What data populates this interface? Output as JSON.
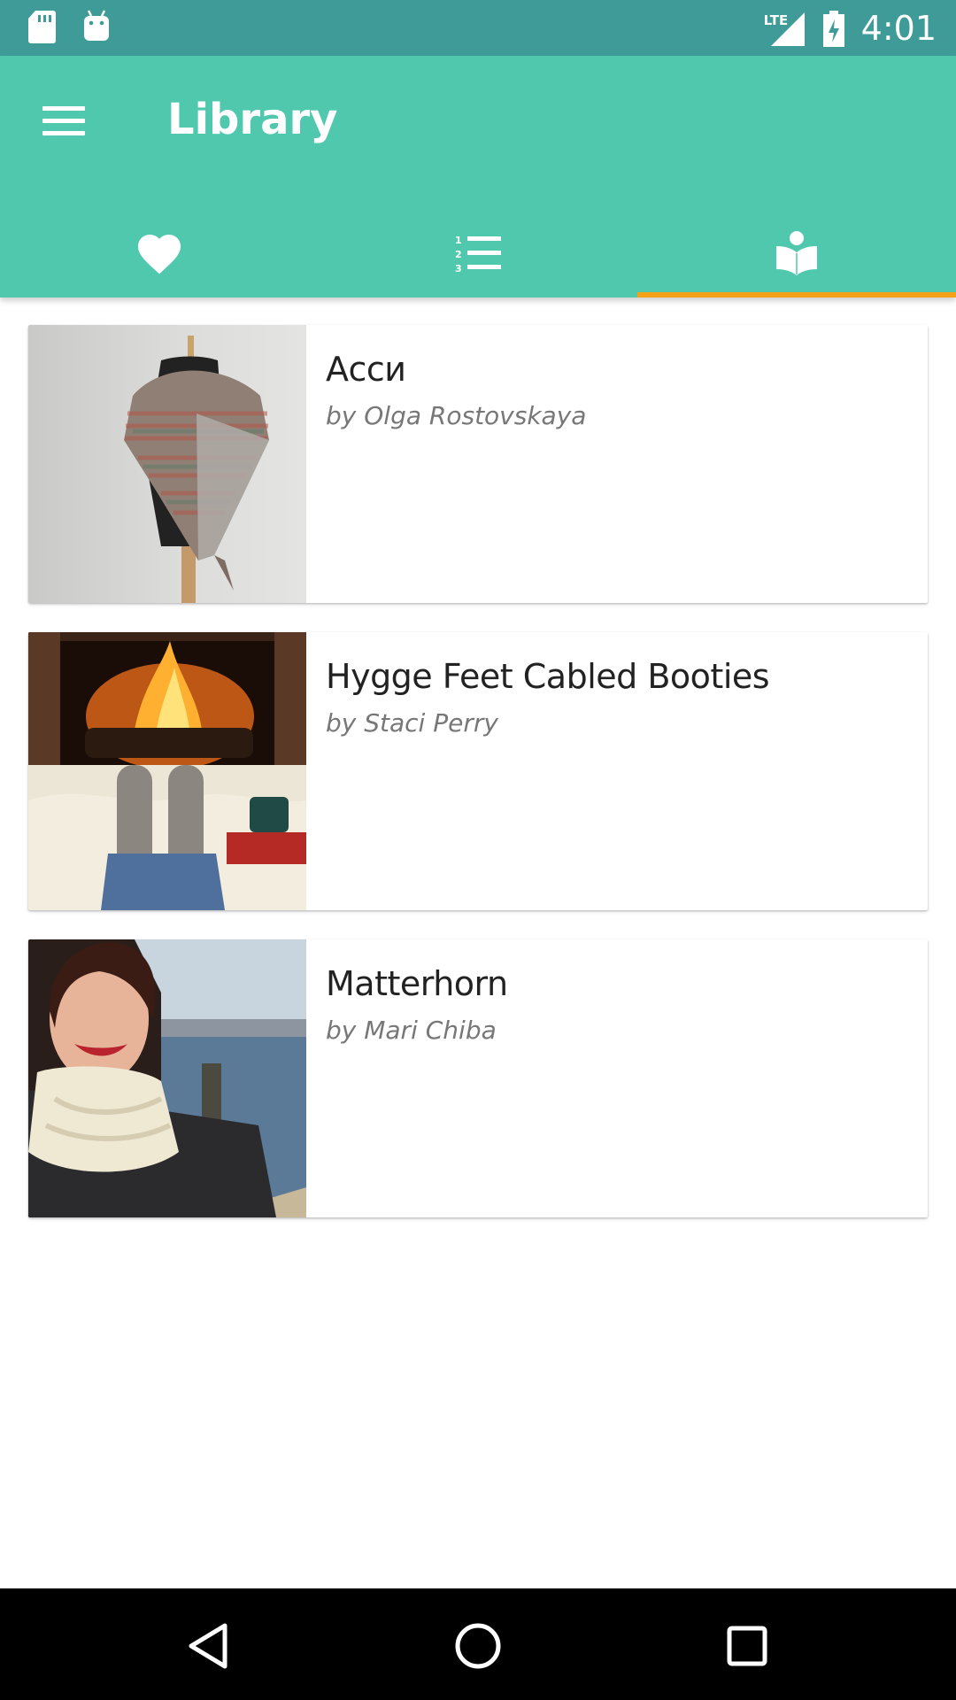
{
  "status_bar": {
    "time": "4:01",
    "network": "LTE",
    "left_icons": [
      "sd-card-icon",
      "android-icon"
    ],
    "right_icons": [
      "signal-icon",
      "battery-charging-icon"
    ]
  },
  "app_bar": {
    "title": "Library",
    "menu_icon": "hamburger-menu-icon",
    "accent_color": "#50c8ae",
    "indicator_color": "#f5a219"
  },
  "tabs": [
    {
      "icon": "heart-icon",
      "active": false
    },
    {
      "icon": "numbered-list-icon",
      "active": false
    },
    {
      "icon": "book-reader-icon",
      "active": true
    }
  ],
  "library_items": [
    {
      "title": "Асси",
      "author": "by Olga Rostovskaya",
      "image": "shawl-on-mannequin-photo"
    },
    {
      "title": "Hygge Feet Cabled Booties",
      "author": "by Staci Perry",
      "image": "feet-by-fireplace-photo"
    },
    {
      "title": "Matterhorn",
      "author": "by Mari Chiba",
      "image": "woman-in-cowl-photo"
    }
  ],
  "nav_bar": {
    "buttons": [
      "back-icon",
      "home-icon",
      "recents-icon"
    ]
  }
}
